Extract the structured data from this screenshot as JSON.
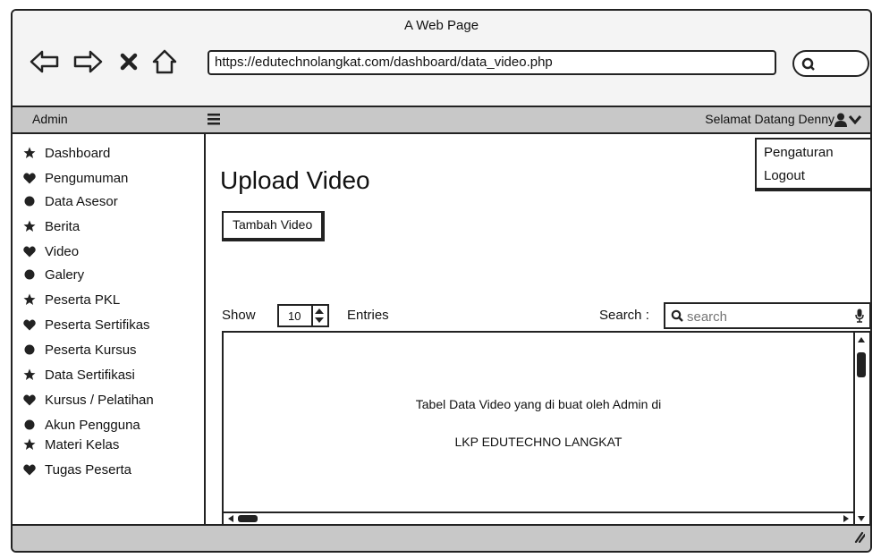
{
  "window": {
    "title": "A Web Page",
    "url": "https://edutechnolangkat.com/dashboard/data_video.php"
  },
  "header": {
    "brand": "Admin",
    "welcome": "Selamat Datang Denny",
    "user_menu": [
      "Pengaturan",
      "Logout"
    ]
  },
  "sidebar": {
    "items": [
      {
        "label": "Dashboard",
        "icon": "star-icon"
      },
      {
        "label": "Pengumuman",
        "icon": "heart-icon"
      },
      {
        "label": "Data Asesor",
        "icon": "circle-icon"
      },
      {
        "label": "Berita",
        "icon": "star-icon"
      },
      {
        "label": "Video",
        "icon": "heart-icon"
      },
      {
        "label": "Galery",
        "icon": "circle-icon"
      },
      {
        "label": "Peserta PKL",
        "icon": "star-icon"
      },
      {
        "label": "Peserta Sertifikas",
        "icon": "heart-icon"
      },
      {
        "label": "Peserta Kursus",
        "icon": "circle-icon"
      },
      {
        "label": "Data Sertifikasi",
        "icon": "star-icon"
      },
      {
        "label": "Kursus / Pelatihan",
        "icon": "heart-icon"
      },
      {
        "label": "Akun Pengguna",
        "icon": "circle-icon"
      },
      {
        "label": "Materi Kelas",
        "icon": "star-icon"
      },
      {
        "label": "Tugas Peserta",
        "icon": "heart-icon"
      }
    ]
  },
  "main": {
    "title": "Upload Video",
    "add_button": "Tambah Video",
    "show_label": "Show",
    "entries_value": "10",
    "entries_label": "Entries",
    "search_label": "Search :",
    "search_placeholder": "search",
    "table_text_line1": "Tabel Data Video yang di buat oleh Admin di",
    "table_text_line2": "LKP EDUTECHNO LANGKAT"
  }
}
